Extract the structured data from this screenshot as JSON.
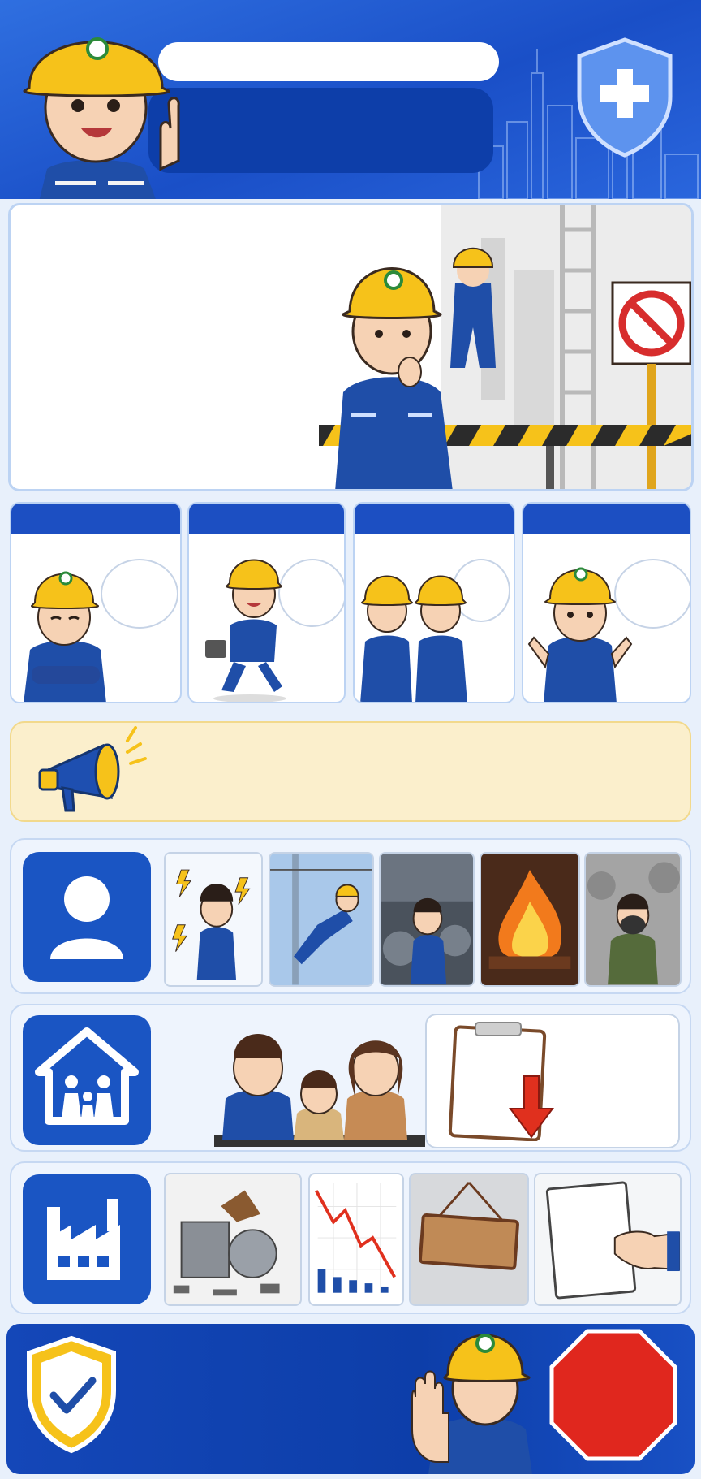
{
  "header": {
    "title": "",
    "subtitle": ""
  },
  "scene": {
    "caption": ""
  },
  "cards": [
    {
      "title": "",
      "bubble": ""
    },
    {
      "title": "",
      "bubble": ""
    },
    {
      "title": "",
      "bubble": ""
    },
    {
      "title": "",
      "bubble": ""
    }
  ],
  "notice": {
    "text": ""
  },
  "rows": [
    {
      "icon": "person-icon",
      "thumbs": [
        "electric-shock-icon",
        "fall-from-height-icon",
        "machine-entrapment-icon",
        "fire-icon",
        "toxic-gas-icon"
      ]
    },
    {
      "icon": "family-home-icon",
      "note": ""
    },
    {
      "icon": "factory-icon",
      "sign": "",
      "paper": ""
    }
  ],
  "footer": {
    "text": "",
    "stop_sign": ""
  },
  "colors": {
    "brand_blue": "#1a55c3",
    "helmet_yellow": "#f6c21a",
    "warning_red": "#d72d2d",
    "notice_bg": "#fbefcc"
  }
}
